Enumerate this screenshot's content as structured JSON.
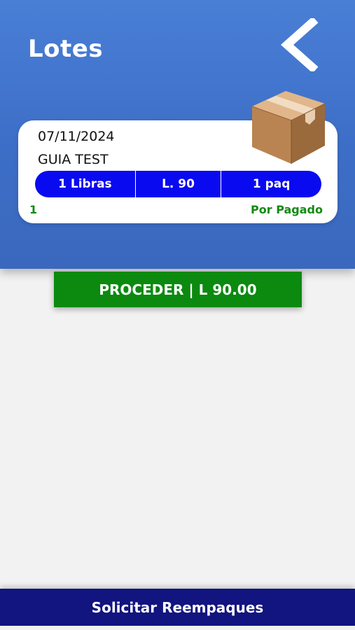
{
  "header": {
    "title": "Lotes",
    "back_icon": "chevron-left-icon"
  },
  "lot_card": {
    "date": "07/11/2024",
    "guide": "GUIA TEST",
    "weight": "1 Libras",
    "price": "L. 90",
    "packages": "1 paq",
    "count": "1",
    "status": "Por Pagado",
    "icon": "cardboard-box-icon"
  },
  "actions": {
    "proceed_label": "PROCEDER | L 90.00",
    "repack_label": "Solicitar Reempaques"
  },
  "colors": {
    "header_blue": "#3d6ec7",
    "pill_blue": "#0a0af0",
    "status_green": "#138a13",
    "proceed_green": "#0b8a0f",
    "footer_navy": "#12147f"
  }
}
